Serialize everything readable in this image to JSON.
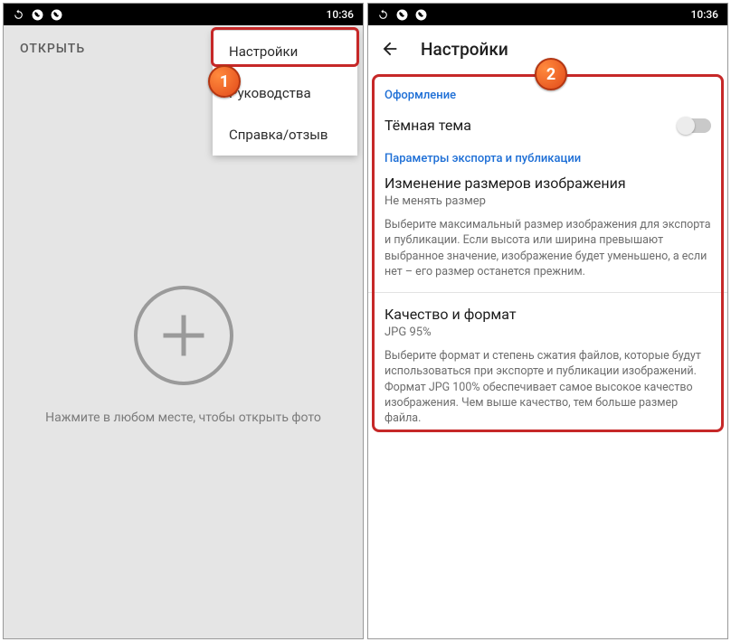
{
  "statusbar": {
    "time": "10:36"
  },
  "left": {
    "toolbar_open": "ОТКРЫТЬ",
    "hint": "Нажмите в любом месте, чтобы открыть фото",
    "menu": {
      "settings": "Настройки",
      "guides": "Руководства",
      "feedback": "Справка/отзыв"
    }
  },
  "right": {
    "title": "Настройки",
    "sections": {
      "appearance": "Оформление",
      "export": "Параметры экспорта и публикации"
    },
    "dark_theme": "Тёмная тема",
    "resize": {
      "title": "Изменение размеров изображения",
      "value": "Не менять размер",
      "desc": "Выберите максимальный размер изображения для экспорта и публикации. Если высота или ширина превышают выбранное значение, изображение будет уменьшено, а если нет – его размер останется прежним."
    },
    "quality": {
      "title": "Качество и формат",
      "value": "JPG 95%",
      "desc": "Выберите формат и степень сжатия файлов, которые будут использоваться при экспорте и публикации изображений. Формат JPG 100% обеспечивает самое высокое качество изображения. Чем выше качество, тем больше размер файла."
    }
  },
  "badges": {
    "one": "1",
    "two": "2"
  }
}
